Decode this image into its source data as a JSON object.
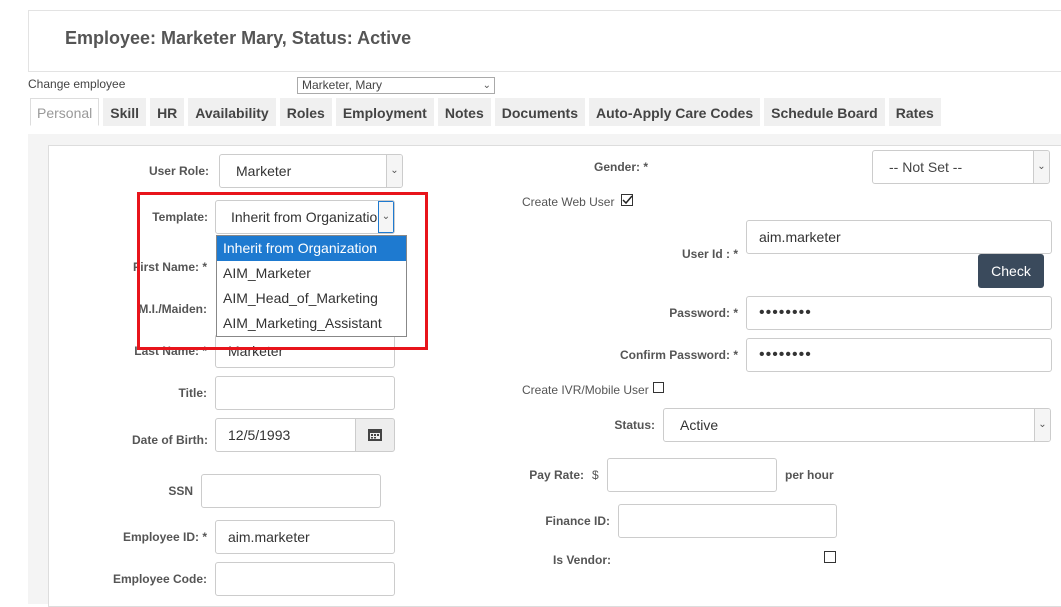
{
  "header": {
    "title": "Employee: Marketer Mary, Status: Active"
  },
  "employee_select": {
    "label": "Change employee",
    "value": "Marketer, Mary"
  },
  "tabs": [
    "Personal",
    "Skill",
    "HR",
    "Availability",
    "Roles",
    "Employment",
    "Notes",
    "Documents",
    "Auto-Apply Care Codes",
    "Schedule Board",
    "Rates"
  ],
  "active_tab": "Personal",
  "left": {
    "user_role": {
      "label": "User Role:",
      "value": "Marketer"
    },
    "template": {
      "label": "Template:",
      "value": "Inherit from Organization"
    },
    "template_options": [
      "Inherit from Organization",
      "AIM_Marketer",
      "AIM_Head_of_Marketing",
      "AIM_Marketing_Assistant"
    ],
    "first_name": {
      "label": "First Name: *"
    },
    "mi": {
      "label": "M.I./Maiden:"
    },
    "last_name": {
      "label": "Last Name: *",
      "value": "Marketer"
    },
    "title": {
      "label": "Title:",
      "value": ""
    },
    "dob": {
      "label": "Date of Birth:",
      "value": "12/5/1993"
    },
    "ssn": {
      "label": "SSN",
      "value": ""
    },
    "employee_id": {
      "label": "Employee ID: *",
      "value": "aim.marketer"
    },
    "employee_code": {
      "label": "Employee Code:",
      "value": ""
    }
  },
  "right": {
    "gender": {
      "label": "Gender: *",
      "value": "-- Not Set --"
    },
    "create_web_user": {
      "label": "Create Web User",
      "checked": true
    },
    "user_id": {
      "label": "User Id : *",
      "value": "aim.marketer"
    },
    "check_button": "Check",
    "password": {
      "label": "Password: *",
      "value": "••••••••"
    },
    "confirm_password": {
      "label": "Confirm Password: *",
      "value": "••••••••"
    },
    "create_ivr": {
      "label": "Create IVR/Mobile User",
      "checked": false
    },
    "status": {
      "label": "Status:",
      "value": "Active"
    },
    "pay_rate": {
      "label": "Pay Rate:",
      "currency": "$",
      "unit": "per hour",
      "value": ""
    },
    "finance_id": {
      "label": "Finance ID:",
      "value": ""
    },
    "is_vendor": {
      "label": "Is Vendor:",
      "checked": false
    }
  },
  "colors": {
    "highlight": "#e8141b",
    "selected_item": "#1e7ad0",
    "check_button": "#3a4a5c"
  }
}
